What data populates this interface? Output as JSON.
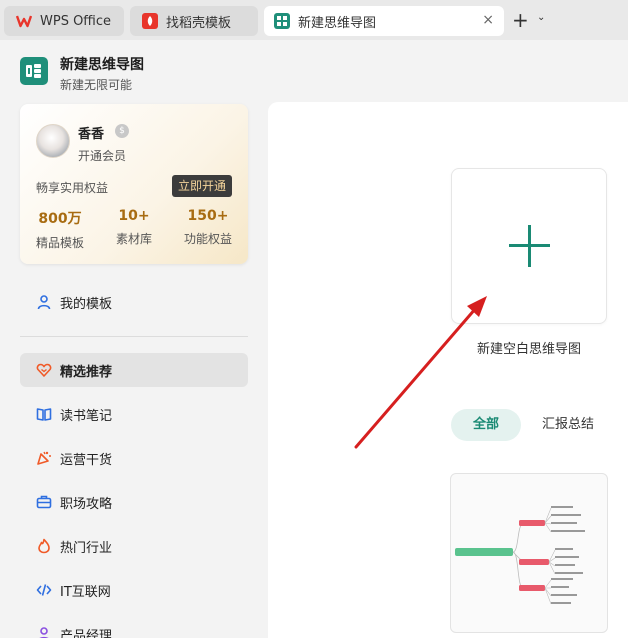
{
  "tabs": [
    {
      "label": "WPS Office"
    },
    {
      "label": "找稻壳模板"
    },
    {
      "label": "新建思维导图"
    }
  ],
  "tab_controls": {
    "close": "×",
    "add": "+",
    "menu": "⌄"
  },
  "header": {
    "title": "新建思维导图",
    "subtitle": "新建无限可能"
  },
  "member": {
    "name": "香香",
    "status": "开通会员",
    "benefit_text": "畅享实用权益",
    "open_button": "立即开通",
    "stats": [
      {
        "value": "800万",
        "label": "精品模板"
      },
      {
        "value": "10+",
        "label": "素材库"
      },
      {
        "value": "150+",
        "label": "功能权益"
      }
    ]
  },
  "sidebar": {
    "my_templates": "我的模板",
    "items": [
      {
        "label": "精选推荐",
        "icon": "heart-icon",
        "active": true
      },
      {
        "label": "读书笔记",
        "icon": "book-icon"
      },
      {
        "label": "运营干货",
        "icon": "party-popper-icon"
      },
      {
        "label": "职场攻略",
        "icon": "briefcase-icon"
      },
      {
        "label": "热门行业",
        "icon": "flame-icon"
      },
      {
        "label": "IT互联网",
        "icon": "code-icon"
      },
      {
        "label": "产品经理",
        "icon": "person-icon"
      }
    ]
  },
  "main": {
    "new_blank_label": "新建空白思维导图",
    "filters": [
      {
        "label": "全部",
        "active": true
      },
      {
        "label": "汇报总结"
      }
    ]
  },
  "colors": {
    "accent": "#1a8a74",
    "arrow": "#d61f1f",
    "gold": "#a86c12",
    "sidebar_icon_blue": "#2f6fe0",
    "sidebar_icon_orange": "#f05a28"
  }
}
